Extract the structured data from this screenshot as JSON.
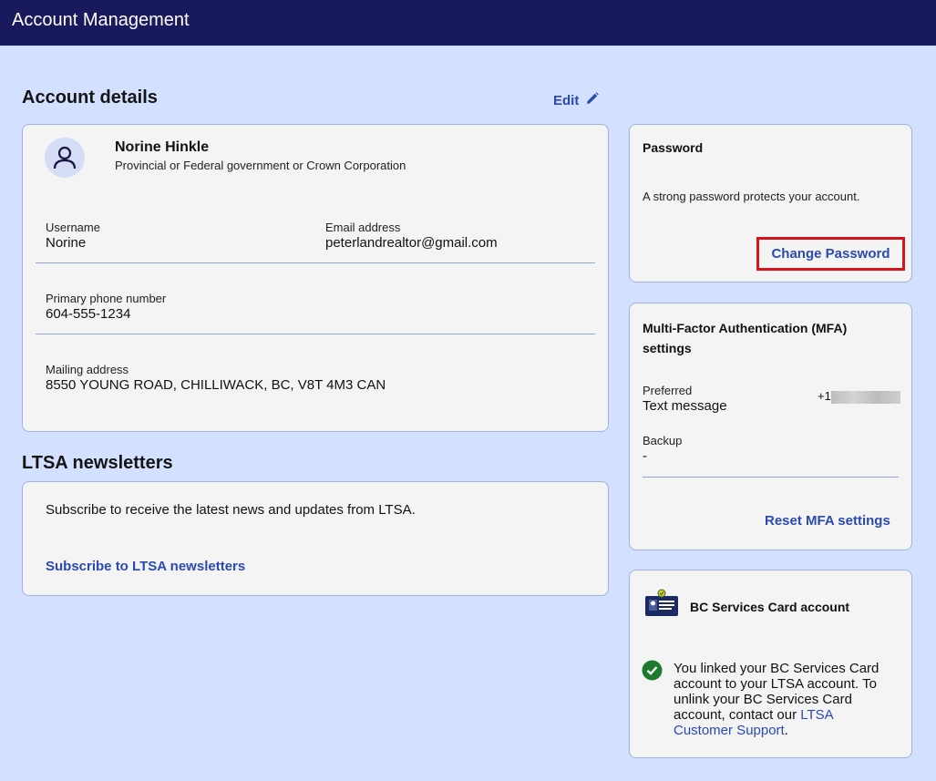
{
  "header": {
    "title": "Account Management"
  },
  "account_details": {
    "title": "Account details",
    "edit_label": "Edit",
    "name": "Norine Hinkle",
    "organization": "Provincial or Federal government or Crown Corporation",
    "username_label": "Username",
    "username": "Norine",
    "email_label": "Email address",
    "email": "peterlandrealtor@gmail.com",
    "phone_label": "Primary phone number",
    "phone": "604-555-1234",
    "address_label": "Mailing address",
    "address": "8550 YOUNG ROAD, CHILLIWACK, BC, V8T 4M3 CAN"
  },
  "newsletters": {
    "title": "LTSA newsletters",
    "description": "Subscribe to receive the latest news and updates from LTSA.",
    "subscribe_label": "Subscribe to LTSA newsletters"
  },
  "password": {
    "title": "Password",
    "description": "A strong password protects your account.",
    "change_label": "Change Password"
  },
  "mfa": {
    "title_line1": "Multi-Factor Authentication (MFA)",
    "title_line2": "settings",
    "preferred_label": "Preferred",
    "preferred_value": "Text message",
    "preferred_phone_prefix": "+1",
    "backup_label": "Backup",
    "backup_value": "-",
    "reset_label": "Reset MFA settings"
  },
  "bcsc": {
    "title": "BC Services Card account",
    "message_part1": "You linked your BC Services Card account to your LTSA account. To unlink your BC Services Card account, contact our ",
    "support_link": "LTSA Customer Support",
    "message_end": "."
  },
  "colors": {
    "topbar": "#19195e",
    "background": "#d3e0ff",
    "card": "#f4f4f4",
    "link": "#2a4ab0",
    "highlight_border": "#d8141a",
    "success": "#1e7a2e"
  }
}
